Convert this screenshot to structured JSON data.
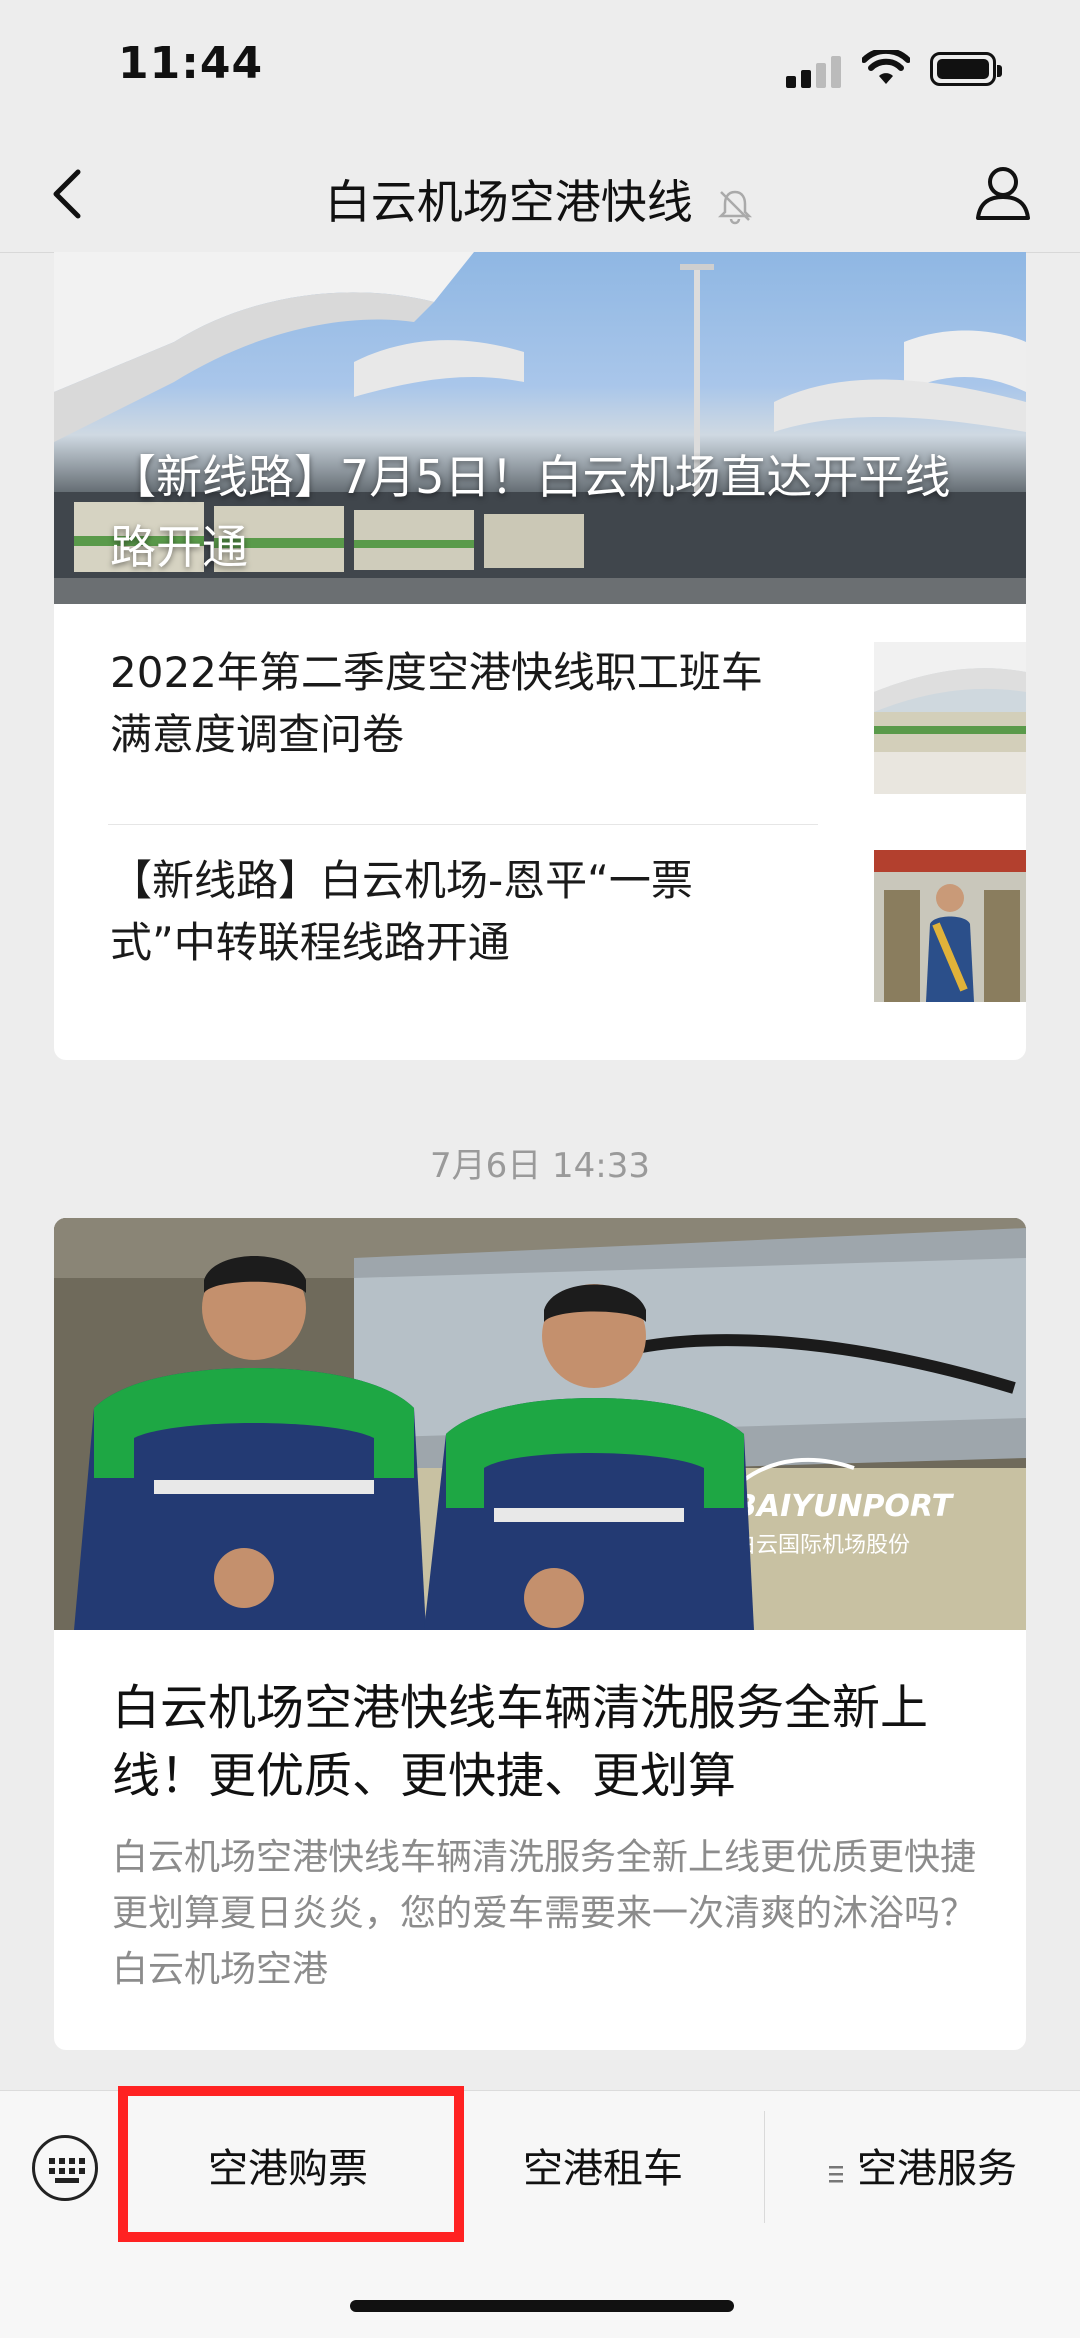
{
  "status_bar": {
    "time": "11:44"
  },
  "nav": {
    "title": "白云机场空港快线"
  },
  "card1": {
    "hero_title": "【新线路】7月5日！白云机场直达开平线路开通",
    "items": [
      {
        "text": "2022年第二季度空港快线职工班车满意度调查问卷"
      },
      {
        "text": "【新线路】白云机场-恩平“一票式”中转联程线路开通"
      }
    ]
  },
  "timestamp": "7月6日 14:33",
  "card2": {
    "title": "白云机场空港快线车辆清洗服务全新上线！更优质、更快捷、更划算",
    "description": "白云机场空港快线车辆清洗服务全新上线更优质更快捷更划算夏日炎炎，您的爱车需要来一次清爽的沐浴吗？白云机场空港",
    "bus_brand": "BAIYUNPORT",
    "bus_brand_cn": "白云国际机场股份"
  },
  "menu": {
    "items": [
      {
        "label": "空港购票"
      },
      {
        "label": "空港租车"
      },
      {
        "label": "空港服务"
      }
    ]
  },
  "colors": {
    "highlight": "#ff2222",
    "background": "#ededed"
  }
}
